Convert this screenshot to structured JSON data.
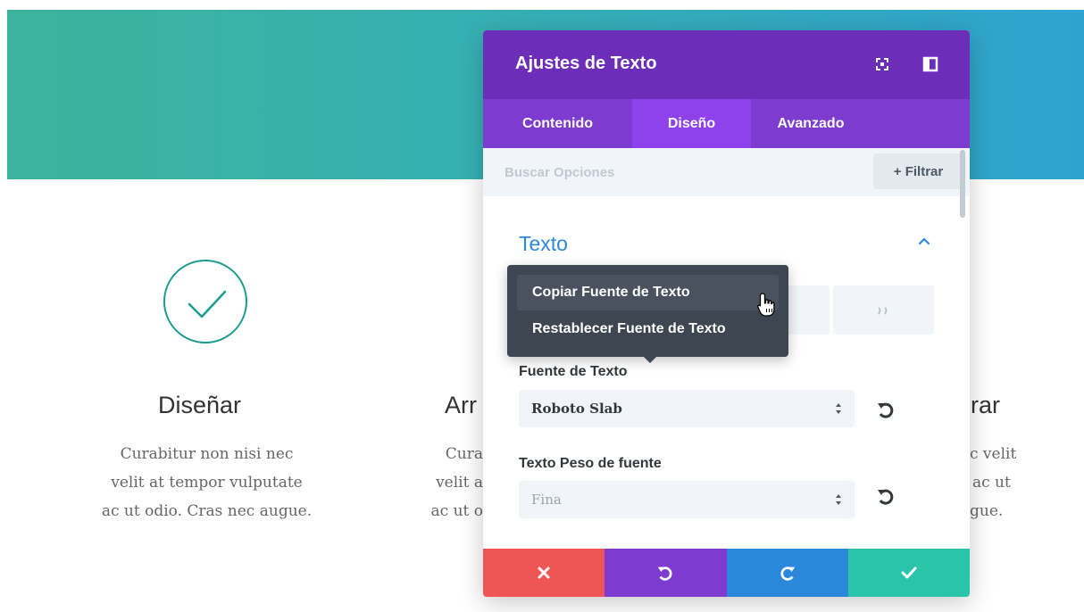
{
  "page": {
    "features": [
      {
        "title": "Diseñar",
        "text_lines": [
          "Curabitur non nisi nec",
          "velit at tempor vulputate",
          "ac ut odio. Cras nec augue."
        ]
      },
      {
        "title": "Arr",
        "text_lines": [
          "Cura",
          "velit a",
          "ac ut o"
        ]
      },
      {
        "title": "rar",
        "text_lines": [
          "c velit",
          "ac ut",
          "gue."
        ]
      }
    ],
    "check_color": "#1a9d8f",
    "check_icon": "checkmark-circle-icon"
  },
  "modal": {
    "title": "Ajustes de Texto",
    "header_icons": [
      "fullscreen-icon",
      "sidebar-dock-icon"
    ],
    "tabs": [
      {
        "label": "Contenido",
        "active": false
      },
      {
        "label": "Diseño",
        "active": true
      },
      {
        "label": "Avanzado",
        "active": false
      }
    ],
    "search": {
      "placeholder": "Buscar Opciones"
    },
    "filter_label": "+ Filtrar",
    "section": {
      "title": "Texto",
      "toggle_icon": "chevron-up-icon"
    },
    "alignment_icons": [
      "align-left-icon",
      "align-center-icon",
      "list-icon",
      "quote-icon"
    ],
    "fields": [
      {
        "label": "Fuente de Texto",
        "value": "Roboto Slab",
        "reset_icon": "undo-icon"
      },
      {
        "label": "Texto Peso de fuente",
        "value": "Fina",
        "reset_icon": "undo-icon"
      }
    ],
    "footer_buttons": [
      {
        "name": "discard",
        "icon": "close-icon",
        "color": "#ef5555"
      },
      {
        "name": "undo",
        "icon": "undo-icon",
        "color": "#7d3bd0"
      },
      {
        "name": "redo",
        "icon": "redo-icon",
        "color": "#2b87da"
      },
      {
        "name": "save",
        "icon": "check-icon",
        "color": "#29c4a9"
      }
    ],
    "colors": {
      "header": "#6c2eb9",
      "tabs": "#7e3bd0",
      "active_tab": "#8f42ec",
      "section_title": "#2b87da"
    }
  },
  "context_menu": {
    "items": [
      {
        "label": "Copiar Fuente de Texto",
        "hovered": true
      },
      {
        "label": "Restablecer Fuente de Texto",
        "hovered": false
      }
    ],
    "cursor_icon": "hand-pointer-icon"
  }
}
